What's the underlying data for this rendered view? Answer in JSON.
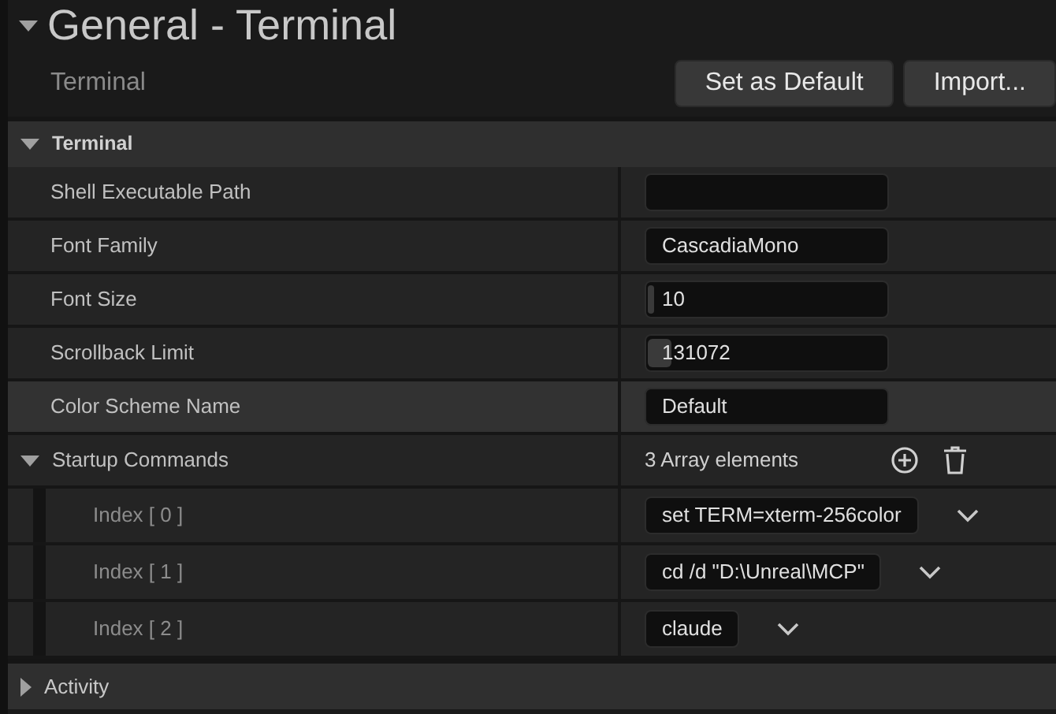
{
  "title": {
    "text": "General - Terminal",
    "expanded": true
  },
  "subheader": {
    "text": "Terminal",
    "buttons": [
      "Set as Default",
      "Import..."
    ]
  },
  "categories": [
    {
      "name": "Terminal",
      "expanded": true,
      "bold": true,
      "properties": [
        {
          "kind": "text",
          "label": "Shell Executable Path",
          "highlighted": false
        },
        {
          "kind": "text",
          "label": "Font Family",
          "value": "CascadiaMono",
          "highlighted": false
        },
        {
          "kind": "number",
          "label": "Font Size",
          "value": "10",
          "level": 0.02,
          "highlighted": false
        },
        {
          "kind": "number",
          "label": "Scrollback Limit",
          "value": "131072",
          "level": 0.1,
          "highlighted": false
        },
        {
          "kind": "text",
          "label": "Color Scheme Name",
          "value": "Default",
          "highlighted": true
        },
        {
          "kind": "array",
          "label": "Startup Commands",
          "expanded": true,
          "summary": "3 Array elements",
          "highlighted": false,
          "elements": [
            {
              "label": "Index [ 0 ]",
              "value": "set TERM=xterm-256color"
            },
            {
              "label": "Index [ 1 ]",
              "value": "cd /d \"D:\\Unreal\\MCP\""
            },
            {
              "label": "Index [ 2 ]",
              "value": "claude"
            }
          ]
        }
      ]
    },
    {
      "name": "Activity",
      "expanded": false,
      "bold": false
    }
  ]
}
